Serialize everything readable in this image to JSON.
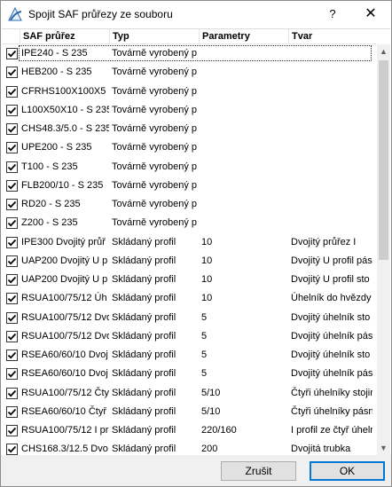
{
  "window": {
    "title": "Spojit SAF průřezy ze souboru",
    "help_label": "?",
    "close_label": "✕"
  },
  "table": {
    "columns": [
      "SAF průřez",
      "Typ",
      "Parametry",
      "Tvar"
    ],
    "rows": [
      {
        "name": "IPE240 - S 235",
        "type": "Továrně vyrobený p",
        "params": "",
        "shape": "",
        "checked": true
      },
      {
        "name": "HEB200 - S 235",
        "type": "Továrně vyrobený p",
        "params": "",
        "shape": "",
        "checked": true
      },
      {
        "name": "CFRHS100X100X5 -",
        "type": "Továrně vyrobený p",
        "params": "",
        "shape": "",
        "checked": true
      },
      {
        "name": "L100X50X10 - S 235",
        "type": "Továrně vyrobený p",
        "params": "",
        "shape": "",
        "checked": true
      },
      {
        "name": "CHS48.3/5.0 - S 235",
        "type": "Továrně vyrobený p",
        "params": "",
        "shape": "",
        "checked": true
      },
      {
        "name": "UPE200 - S 235",
        "type": "Továrně vyrobený p",
        "params": "",
        "shape": "",
        "checked": true
      },
      {
        "name": "T100 - S 235",
        "type": "Továrně vyrobený p",
        "params": "",
        "shape": "",
        "checked": true
      },
      {
        "name": "FLB200/10 - S 235",
        "type": "Továrně vyrobený p",
        "params": "",
        "shape": "",
        "checked": true
      },
      {
        "name": "RD20 - S 235",
        "type": "Továrně vyrobený p",
        "params": "",
        "shape": "",
        "checked": true
      },
      {
        "name": "Z200 - S 235",
        "type": "Továrně vyrobený p",
        "params": "",
        "shape": "",
        "checked": true
      },
      {
        "name": "IPE300 Dvojitý průř",
        "type": "Skládaný profil",
        "params": "10",
        "shape": "Dvojitý průřez I",
        "checked": true
      },
      {
        "name": "UAP200 Dvojitý U p",
        "type": "Skládaný profil",
        "params": "10",
        "shape": "Dvojitý U profil pás",
        "checked": true
      },
      {
        "name": "UAP200 Dvojitý U p",
        "type": "Skládaný profil",
        "params": "10",
        "shape": "Dvojitý U profil sto",
        "checked": true
      },
      {
        "name": "RSUA100/75/12 Úh",
        "type": "Skládaný profil",
        "params": "10",
        "shape": "Úhelník do hvězdy",
        "checked": true
      },
      {
        "name": "RSUA100/75/12 Dvo",
        "type": "Skládaný profil",
        "params": "5",
        "shape": "Dvojitý úhelník sto",
        "checked": true
      },
      {
        "name": "RSUA100/75/12 Dvo",
        "type": "Skládaný profil",
        "params": "5",
        "shape": "Dvojitý úhelník pás",
        "checked": true
      },
      {
        "name": "RSEA60/60/10 Dvoj",
        "type": "Skládaný profil",
        "params": "5",
        "shape": "Dvojitý úhelník sto",
        "checked": true
      },
      {
        "name": "RSEA60/60/10 Dvoj",
        "type": "Skládaný profil",
        "params": "5",
        "shape": "Dvojitý úhelník pás",
        "checked": true
      },
      {
        "name": "RSUA100/75/12 Čty",
        "type": "Skládaný profil",
        "params": "5/10",
        "shape": "Čtyři úhelníky stojin",
        "checked": true
      },
      {
        "name": "RSEA60/60/10 Čtyř",
        "type": "Skládaný profil",
        "params": "5/10",
        "shape": "Čtyři úhelníky pásn",
        "checked": true
      },
      {
        "name": "RSUA100/75/12 I pr",
        "type": "Skládaný profil",
        "params": "220/160",
        "shape": "I profil ze čtyř úhelní",
        "checked": true
      },
      {
        "name": "CHS168.3/12.5 Dvo",
        "type": "Skládaný profil",
        "params": "200",
        "shape": "Dvojitá trubka",
        "checked": true
      }
    ]
  },
  "scrollbar": {
    "up_glyph": "▲",
    "down_glyph": "▼"
  },
  "buttons": {
    "cancel_label": "Zrušit",
    "ok_label": "OK"
  },
  "colors": {
    "accent": "#0078d7",
    "app_icon": "#2b6cb0"
  }
}
